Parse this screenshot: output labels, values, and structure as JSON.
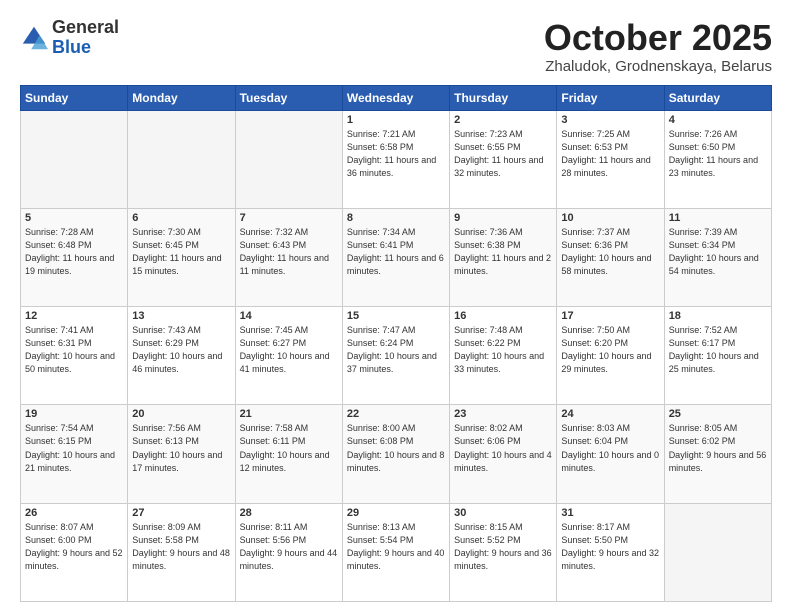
{
  "logo": {
    "general": "General",
    "blue": "Blue"
  },
  "header": {
    "month": "October 2025",
    "location": "Zhaludok, Grodnenskaya, Belarus"
  },
  "days_of_week": [
    "Sunday",
    "Monday",
    "Tuesday",
    "Wednesday",
    "Thursday",
    "Friday",
    "Saturday"
  ],
  "weeks": [
    [
      {
        "day": "",
        "sunrise": "",
        "sunset": "",
        "daylight": ""
      },
      {
        "day": "",
        "sunrise": "",
        "sunset": "",
        "daylight": ""
      },
      {
        "day": "",
        "sunrise": "",
        "sunset": "",
        "daylight": ""
      },
      {
        "day": "1",
        "sunrise": "Sunrise: 7:21 AM",
        "sunset": "Sunset: 6:58 PM",
        "daylight": "Daylight: 11 hours and 36 minutes."
      },
      {
        "day": "2",
        "sunrise": "Sunrise: 7:23 AM",
        "sunset": "Sunset: 6:55 PM",
        "daylight": "Daylight: 11 hours and 32 minutes."
      },
      {
        "day": "3",
        "sunrise": "Sunrise: 7:25 AM",
        "sunset": "Sunset: 6:53 PM",
        "daylight": "Daylight: 11 hours and 28 minutes."
      },
      {
        "day": "4",
        "sunrise": "Sunrise: 7:26 AM",
        "sunset": "Sunset: 6:50 PM",
        "daylight": "Daylight: 11 hours and 23 minutes."
      }
    ],
    [
      {
        "day": "5",
        "sunrise": "Sunrise: 7:28 AM",
        "sunset": "Sunset: 6:48 PM",
        "daylight": "Daylight: 11 hours and 19 minutes."
      },
      {
        "day": "6",
        "sunrise": "Sunrise: 7:30 AM",
        "sunset": "Sunset: 6:45 PM",
        "daylight": "Daylight: 11 hours and 15 minutes."
      },
      {
        "day": "7",
        "sunrise": "Sunrise: 7:32 AM",
        "sunset": "Sunset: 6:43 PM",
        "daylight": "Daylight: 11 hours and 11 minutes."
      },
      {
        "day": "8",
        "sunrise": "Sunrise: 7:34 AM",
        "sunset": "Sunset: 6:41 PM",
        "daylight": "Daylight: 11 hours and 6 minutes."
      },
      {
        "day": "9",
        "sunrise": "Sunrise: 7:36 AM",
        "sunset": "Sunset: 6:38 PM",
        "daylight": "Daylight: 11 hours and 2 minutes."
      },
      {
        "day": "10",
        "sunrise": "Sunrise: 7:37 AM",
        "sunset": "Sunset: 6:36 PM",
        "daylight": "Daylight: 10 hours and 58 minutes."
      },
      {
        "day": "11",
        "sunrise": "Sunrise: 7:39 AM",
        "sunset": "Sunset: 6:34 PM",
        "daylight": "Daylight: 10 hours and 54 minutes."
      }
    ],
    [
      {
        "day": "12",
        "sunrise": "Sunrise: 7:41 AM",
        "sunset": "Sunset: 6:31 PM",
        "daylight": "Daylight: 10 hours and 50 minutes."
      },
      {
        "day": "13",
        "sunrise": "Sunrise: 7:43 AM",
        "sunset": "Sunset: 6:29 PM",
        "daylight": "Daylight: 10 hours and 46 minutes."
      },
      {
        "day": "14",
        "sunrise": "Sunrise: 7:45 AM",
        "sunset": "Sunset: 6:27 PM",
        "daylight": "Daylight: 10 hours and 41 minutes."
      },
      {
        "day": "15",
        "sunrise": "Sunrise: 7:47 AM",
        "sunset": "Sunset: 6:24 PM",
        "daylight": "Daylight: 10 hours and 37 minutes."
      },
      {
        "day": "16",
        "sunrise": "Sunrise: 7:48 AM",
        "sunset": "Sunset: 6:22 PM",
        "daylight": "Daylight: 10 hours and 33 minutes."
      },
      {
        "day": "17",
        "sunrise": "Sunrise: 7:50 AM",
        "sunset": "Sunset: 6:20 PM",
        "daylight": "Daylight: 10 hours and 29 minutes."
      },
      {
        "day": "18",
        "sunrise": "Sunrise: 7:52 AM",
        "sunset": "Sunset: 6:17 PM",
        "daylight": "Daylight: 10 hours and 25 minutes."
      }
    ],
    [
      {
        "day": "19",
        "sunrise": "Sunrise: 7:54 AM",
        "sunset": "Sunset: 6:15 PM",
        "daylight": "Daylight: 10 hours and 21 minutes."
      },
      {
        "day": "20",
        "sunrise": "Sunrise: 7:56 AM",
        "sunset": "Sunset: 6:13 PM",
        "daylight": "Daylight: 10 hours and 17 minutes."
      },
      {
        "day": "21",
        "sunrise": "Sunrise: 7:58 AM",
        "sunset": "Sunset: 6:11 PM",
        "daylight": "Daylight: 10 hours and 12 minutes."
      },
      {
        "day": "22",
        "sunrise": "Sunrise: 8:00 AM",
        "sunset": "Sunset: 6:08 PM",
        "daylight": "Daylight: 10 hours and 8 minutes."
      },
      {
        "day": "23",
        "sunrise": "Sunrise: 8:02 AM",
        "sunset": "Sunset: 6:06 PM",
        "daylight": "Daylight: 10 hours and 4 minutes."
      },
      {
        "day": "24",
        "sunrise": "Sunrise: 8:03 AM",
        "sunset": "Sunset: 6:04 PM",
        "daylight": "Daylight: 10 hours and 0 minutes."
      },
      {
        "day": "25",
        "sunrise": "Sunrise: 8:05 AM",
        "sunset": "Sunset: 6:02 PM",
        "daylight": "Daylight: 9 hours and 56 minutes."
      }
    ],
    [
      {
        "day": "26",
        "sunrise": "Sunrise: 8:07 AM",
        "sunset": "Sunset: 6:00 PM",
        "daylight": "Daylight: 9 hours and 52 minutes."
      },
      {
        "day": "27",
        "sunrise": "Sunrise: 8:09 AM",
        "sunset": "Sunset: 5:58 PM",
        "daylight": "Daylight: 9 hours and 48 minutes."
      },
      {
        "day": "28",
        "sunrise": "Sunrise: 8:11 AM",
        "sunset": "Sunset: 5:56 PM",
        "daylight": "Daylight: 9 hours and 44 minutes."
      },
      {
        "day": "29",
        "sunrise": "Sunrise: 8:13 AM",
        "sunset": "Sunset: 5:54 PM",
        "daylight": "Daylight: 9 hours and 40 minutes."
      },
      {
        "day": "30",
        "sunrise": "Sunrise: 8:15 AM",
        "sunset": "Sunset: 5:52 PM",
        "daylight": "Daylight: 9 hours and 36 minutes."
      },
      {
        "day": "31",
        "sunrise": "Sunrise: 8:17 AM",
        "sunset": "Sunset: 5:50 PM",
        "daylight": "Daylight: 9 hours and 32 minutes."
      },
      {
        "day": "",
        "sunrise": "",
        "sunset": "",
        "daylight": ""
      }
    ]
  ]
}
